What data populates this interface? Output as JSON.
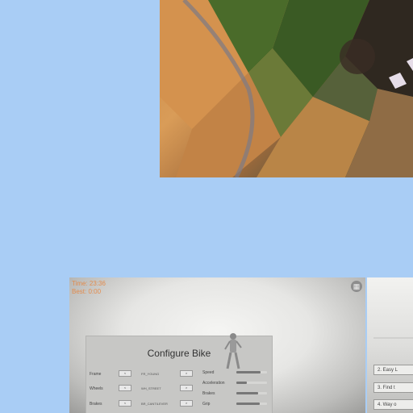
{
  "hud": {
    "time": "Time: 23:36",
    "best": "Best: 0:00"
  },
  "config_panel": {
    "title": "Configure Bike",
    "rows": [
      {
        "label": "Frame",
        "left_value": "FR_YOUNG",
        "arrow_left": "<",
        "arrow_right": ">"
      },
      {
        "label": "Wheels",
        "left_value": "WH_STREET",
        "arrow_left": "<",
        "arrow_right": ">"
      },
      {
        "label": "Brakes",
        "left_value": "BR_CANTILEVER",
        "arrow_left": "<",
        "arrow_right": ">"
      }
    ],
    "stats": [
      {
        "label": "Speed",
        "value": 0.8
      },
      {
        "label": "Acceleration",
        "value": 0.35
      },
      {
        "label": "Brakes",
        "value": 0.7
      },
      {
        "label": "Grip",
        "value": 0.75
      }
    ]
  },
  "side_list": {
    "items": [
      "2. Easy L",
      "3. Find t",
      "4. Way o"
    ]
  },
  "icons": {
    "menu": "grid-icon",
    "rider": "cyclist-figure"
  },
  "colors": {
    "background": "#a9cdf5",
    "hud": "#e8833a"
  }
}
